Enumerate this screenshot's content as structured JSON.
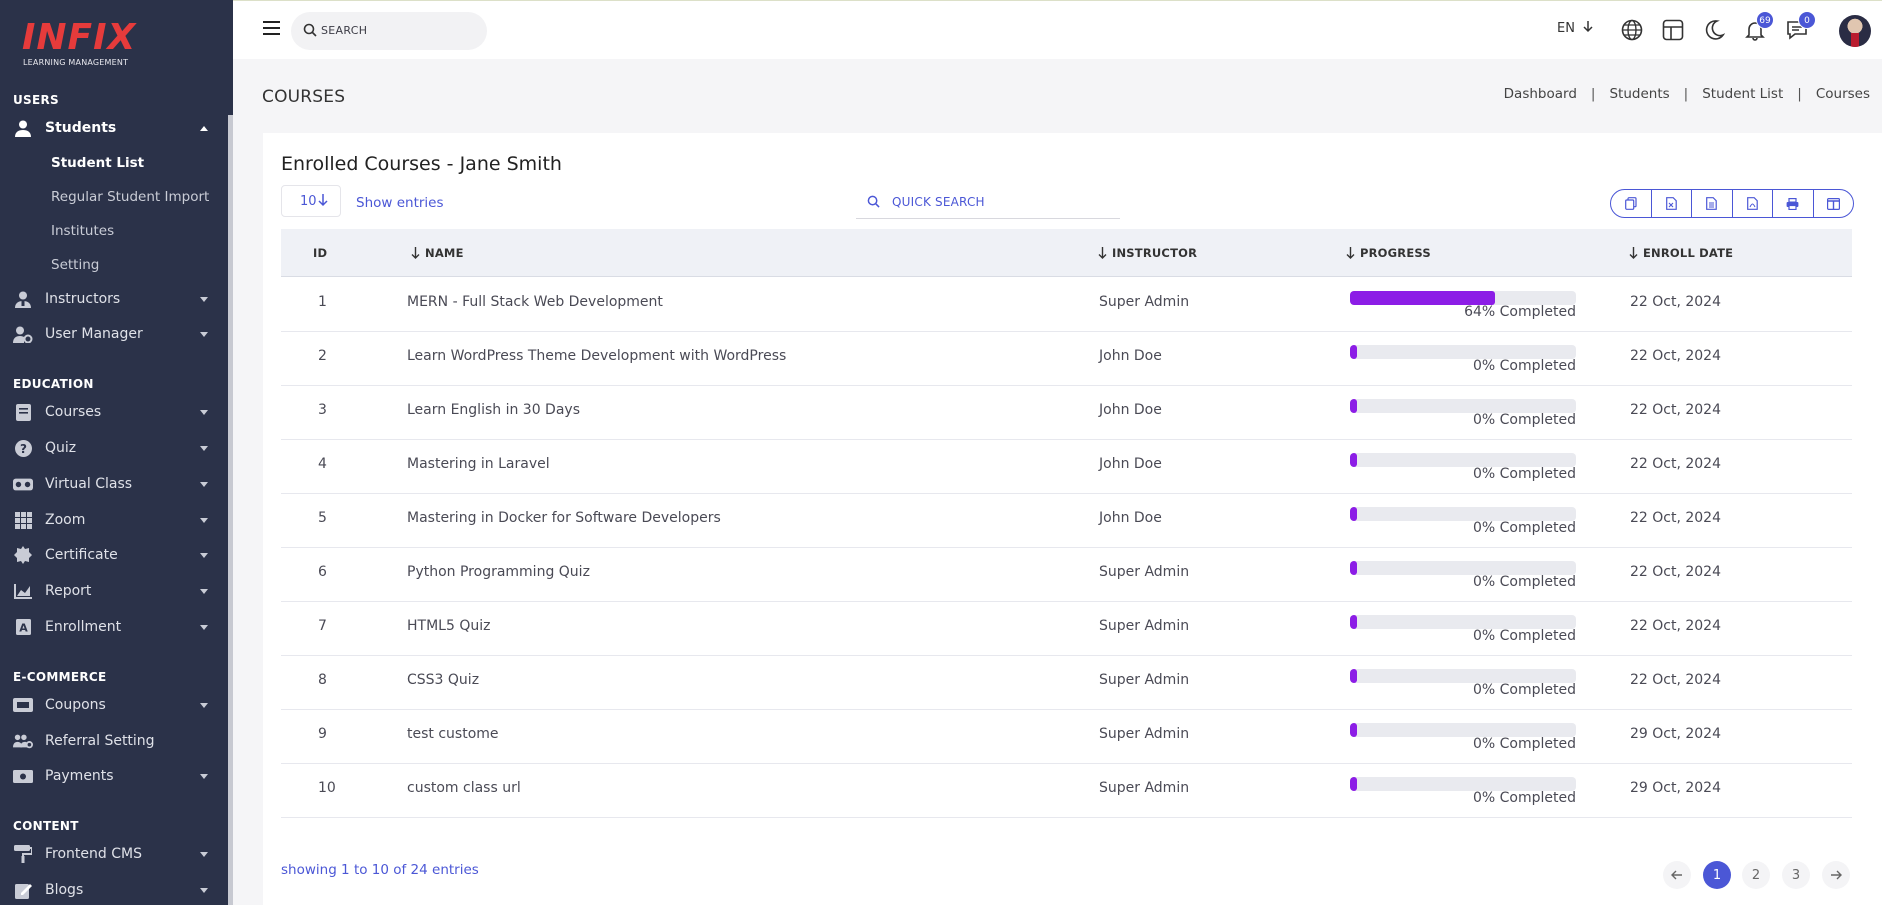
{
  "app": {
    "logo_text": "INFIX",
    "logo_subtitle": "LEARNING MANAGEMENT"
  },
  "topbar": {
    "search_placeholder": "SEARCH",
    "language": "EN",
    "notifications_count": "69",
    "messages_count": "0"
  },
  "sidebar": {
    "sections": {
      "users": "USERS",
      "education": "EDUCATION",
      "ecommerce": "E-COMMERCE",
      "content": "CONTENT"
    },
    "items": {
      "students": "Students",
      "student_list": "Student List",
      "regular_student_import": "Regular Student Import",
      "institutes": "Institutes",
      "setting": "Setting",
      "instructors": "Instructors",
      "user_manager": "User Manager",
      "courses": "Courses",
      "quiz": "Quiz",
      "virtual_class": "Virtual Class",
      "zoom": "Zoom",
      "certificate": "Certificate",
      "report": "Report",
      "enrollment": "Enrollment",
      "coupons": "Coupons",
      "referral_setting": "Referral Setting",
      "payments": "Payments",
      "frontend_cms": "Frontend CMS",
      "blogs": "Blogs"
    }
  },
  "page": {
    "title": "COURSES",
    "breadcrumb": [
      "Dashboard",
      "Students",
      "Student List",
      "Courses"
    ]
  },
  "card": {
    "title": "Enrolled Courses - Jane Smith",
    "entries_value": "10",
    "show_entries_label": "Show entries",
    "quick_search_placeholder": "QUICK SEARCH"
  },
  "table": {
    "headers": {
      "id": "ID",
      "name": "NAME",
      "instructor": "INSTRUCTOR",
      "progress": "PROGRESS",
      "enroll_date": "ENROLL DATE"
    },
    "rows": [
      {
        "id": "1",
        "name": "MERN - Full Stack Web Development",
        "instructor": "Super Admin",
        "progress": 64,
        "progress_label": "64% Completed",
        "date": "22 Oct, 2024"
      },
      {
        "id": "2",
        "name": "Learn WordPress Theme Development with WordPress",
        "instructor": "John Doe",
        "progress": 0,
        "progress_label": "0% Completed",
        "date": "22 Oct, 2024"
      },
      {
        "id": "3",
        "name": "Learn English in 30 Days",
        "instructor": "John Doe",
        "progress": 0,
        "progress_label": "0% Completed",
        "date": "22 Oct, 2024"
      },
      {
        "id": "4",
        "name": "Mastering in Laravel",
        "instructor": "John Doe",
        "progress": 0,
        "progress_label": "0% Completed",
        "date": "22 Oct, 2024"
      },
      {
        "id": "5",
        "name": "Mastering in Docker for Software Developers",
        "instructor": "John Doe",
        "progress": 0,
        "progress_label": "0% Completed",
        "date": "22 Oct, 2024"
      },
      {
        "id": "6",
        "name": "Python Programming Quiz",
        "instructor": "Super Admin",
        "progress": 0,
        "progress_label": "0% Completed",
        "date": "22 Oct, 2024"
      },
      {
        "id": "7",
        "name": "HTML5 Quiz",
        "instructor": "Super Admin",
        "progress": 0,
        "progress_label": "0% Completed",
        "date": "22 Oct, 2024"
      },
      {
        "id": "8",
        "name": "CSS3 Quiz",
        "instructor": "Super Admin",
        "progress": 0,
        "progress_label": "0% Completed",
        "date": "22 Oct, 2024"
      },
      {
        "id": "9",
        "name": "test custome",
        "instructor": "Super Admin",
        "progress": 0,
        "progress_label": "0% Completed",
        "date": "29 Oct, 2024"
      },
      {
        "id": "10",
        "name": "custom class url",
        "instructor": "Super Admin",
        "progress": 0,
        "progress_label": "0% Completed",
        "date": "29 Oct, 2024"
      }
    ]
  },
  "footer": {
    "showing_text": "showing 1 to 10 of 24 entries",
    "pages": [
      "1",
      "2",
      "3"
    ],
    "current_page": "1"
  },
  "colors": {
    "accent": "#4b57d6",
    "progress": "#8c1de6",
    "sidebar_bg": "#2b3249",
    "logo": "#e63b3b"
  }
}
